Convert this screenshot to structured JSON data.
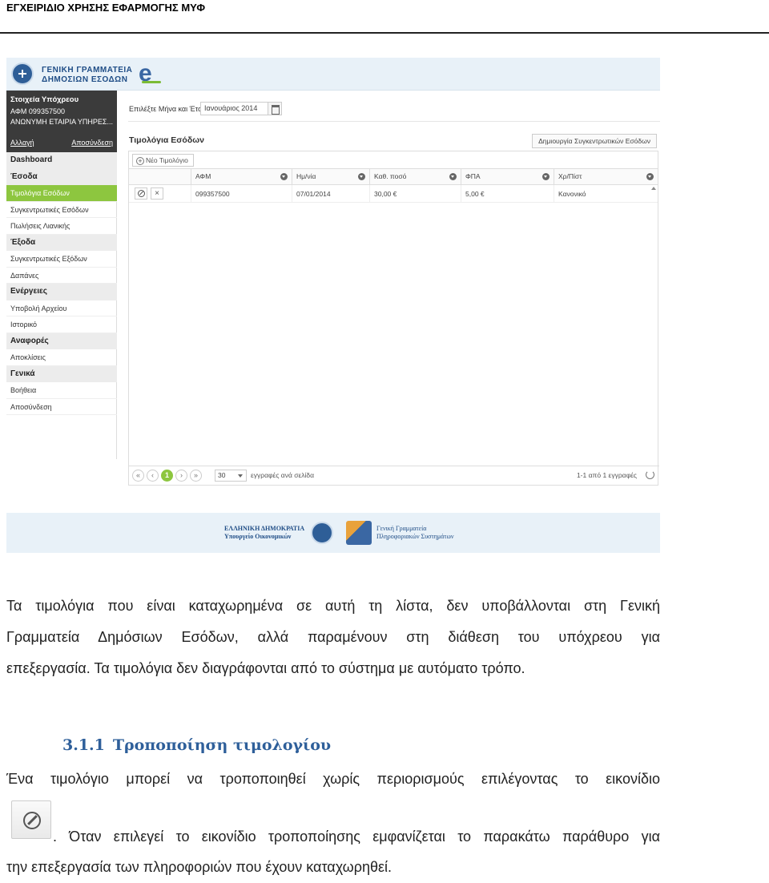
{
  "doc_header": "ΕΓΧΕΙΡΙΔΙΟ ΧΡΗΣΗΣ ΕΦΑΡΜΟΓΗΣ ΜΥΦ",
  "app": {
    "banner": {
      "org_line1": "ΓΕΝΙΚΗ ΓΡΑΜΜΑΤΕΙΑ",
      "org_line2": "ΔΗΜΟΣΙΩΝ ΕΣΟΔΩΝ",
      "logo_letter": "e"
    },
    "taxpayer": {
      "title": "Στοιχεία Υπόχρεου",
      "afm": "ΑΦΜ 099357500",
      "name": "ΑΝΩΝΥΜΗ ΕΤΑΙΡΙΑ ΥΠΗΡΕΣ...",
      "change_link": "Αλλαγή",
      "logout_link": "Αποσύνδεση"
    },
    "menu": {
      "dashboard": "Dashboard",
      "income_section": "Έσοδα",
      "income_invoices": "Τιμολόγια Εσόδων",
      "income_summaries": "Συγκεντρωτικές Εσόδων",
      "retail_sales": "Πωλήσεις Λιανικής",
      "expense_section": "Έξοδα",
      "expense_summaries": "Συγκεντρωτικές Εξόδων",
      "expenses": "Δαπάνες",
      "actions_section": "Ενέργειες",
      "file_upload": "Υποβολή Αρχείου",
      "history": "Ιστορικό",
      "reports_section": "Αναφορές",
      "receipts": "Αποκλίσεις",
      "general_section": "Γενικά",
      "help": "Βοήθεια",
      "logout": "Αποσύνδεση"
    },
    "picker": {
      "label": "Επιλέξτε Μήνα και Έτος:",
      "value": "Ιανουάριος 2014"
    },
    "panel": {
      "title": "Τιμολόγια Εσόδων",
      "create_summary_button": "Δημιουργία Συγκεντρωτικών Εσόδων",
      "new_invoice_button": "Νέο Τιμολόγιο"
    },
    "grid": {
      "columns": [
        "ΑΦΜ",
        "Ημ/νία",
        "Καθ. ποσό",
        "ΦΠΑ",
        "Χρ/Πίστ"
      ],
      "rows": [
        [
          "099357500",
          "07/01/2014",
          "30,00 €",
          "5,00 €",
          "Κανονικό"
        ]
      ]
    },
    "pager": {
      "current_page": "1",
      "page_size": "30",
      "per_page_label": "εγγραφές ανά σελίδα",
      "count": "1-1 από 1 εγγραφές"
    },
    "footer": {
      "line1": "ΕΛΛΗΝΙΚΗ ΔΗΜΟΚΡΑΤΙΑ",
      "line2": "Υπουργείο Οικονομικών",
      "gs_line1": "Γενική Γραμματεία",
      "gs_line2": "Πληροφοριακών Συστημάτων"
    }
  },
  "text": {
    "p1_l1": "Τα τιμολόγια που είναι καταχωρημένα σε αυτή τη λίστα, δεν υποβάλλονται στη Γενική",
    "p1_l2": "Γραμματεία Δημόσιων Εσόδων, αλλά παραμένουν στη διάθεση του υπόχρεου για",
    "p1_l3": "επεξεργασία. Τα τιμολόγια δεν διαγράφονται από το σύστημα με αυτόματο τρόπο.",
    "heading_number": "3.1.1",
    "heading_title": "Τροποποίηση τιμολογίου",
    "p2_l1": "Ένα τιμολόγιο μπορεί να τροποποιηθεί χωρίς περιορισμούς επιλέγοντας το εικονίδιο",
    "p2_l2": ". Όταν επιλεγεί το εικονίδιο τροποποίησης εμφανίζεται το παρακάτω παράθυρο για",
    "p2_l3": "την επεξεργασία των πληροφοριών που έχουν καταχωρηθεί."
  }
}
